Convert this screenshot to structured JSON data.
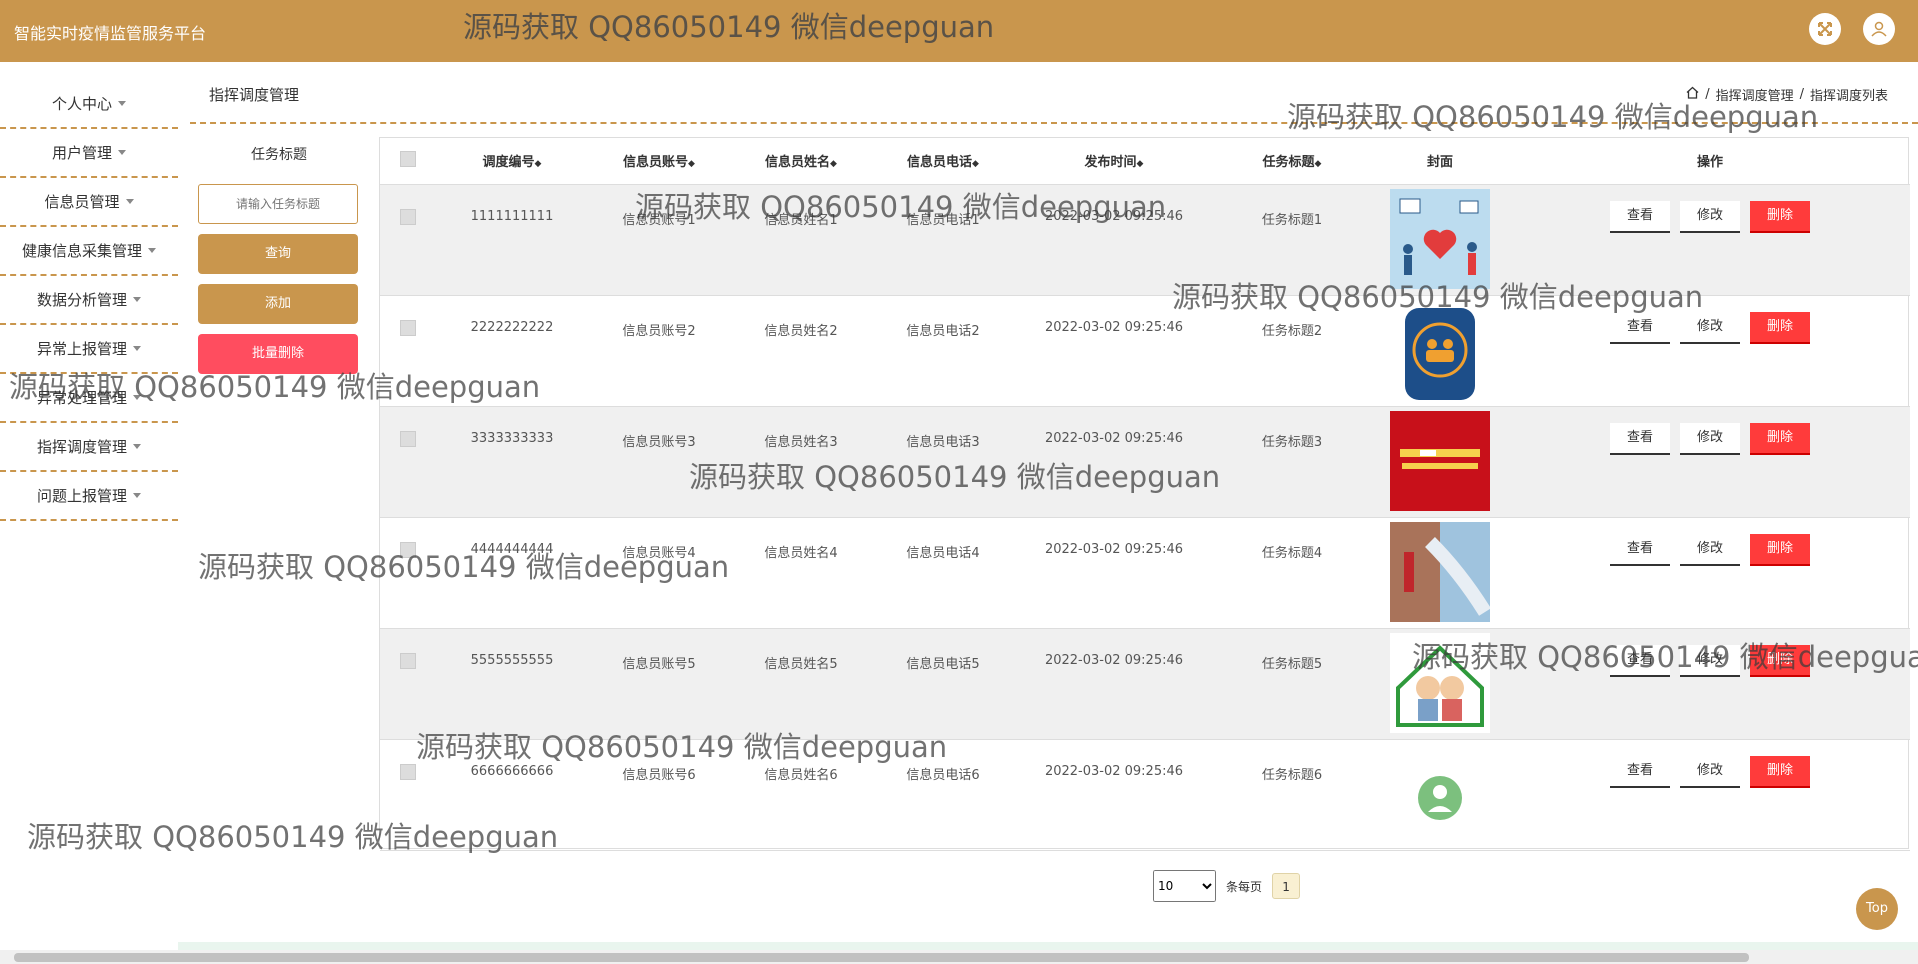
{
  "header": {
    "app_title": "智能实时疫情监管服务平台",
    "watermark": "源码获取 QQ86050149 微信deepguan",
    "fullscreen_icon": "fullscreen-icon",
    "user_icon": "user-icon"
  },
  "sidebar": {
    "items": [
      {
        "label": "个人中心"
      },
      {
        "label": "用户管理"
      },
      {
        "label": "信息员管理"
      },
      {
        "label": "健康信息采集管理"
      },
      {
        "label": "数据分析管理"
      },
      {
        "label": "异常上报管理"
      },
      {
        "label": "异常处理管理"
      },
      {
        "label": "指挥调度管理"
      },
      {
        "label": "问题上报管理"
      }
    ]
  },
  "page": {
    "title": "指挥调度管理",
    "breadcrumb": [
      "指挥调度管理",
      "指挥调度列表"
    ]
  },
  "filter": {
    "label": "任务标题",
    "placeholder": "请输入任务标题",
    "search_label": "查询",
    "add_label": "添加",
    "batch_delete_label": "批量删除"
  },
  "table": {
    "columns": [
      "调度编号",
      "信息员账号",
      "信息员姓名",
      "信息员电话",
      "发布时间",
      "任务标题",
      "封面",
      "操作"
    ],
    "rows": [
      {
        "id": "1111111111",
        "account": "信息员账号1",
        "name": "信息员姓名1",
        "phone": "信息员电话1",
        "time": "2022-03-02 09:25:46",
        "title": "任务标题1",
        "cover": "medical-heart-illustration"
      },
      {
        "id": "2222222222",
        "account": "信息员账号2",
        "name": "信息员姓名2",
        "phone": "信息员电话2",
        "time": "2022-03-02 09:25:46",
        "title": "任务标题2",
        "cover": "community-app-icon"
      },
      {
        "id": "3333333333",
        "account": "信息员账号3",
        "name": "信息员姓名3",
        "phone": "信息员电话3",
        "time": "2022-03-02 09:25:46",
        "title": "任务标题3",
        "cover": "red-banner-poster"
      },
      {
        "id": "4444444444",
        "account": "信息员账号4",
        "name": "信息员姓名4",
        "phone": "信息员电话4",
        "time": "2022-03-02 09:25:46",
        "title": "任务标题4",
        "cover": "face-mask-photo"
      },
      {
        "id": "5555555555",
        "account": "信息员账号5",
        "name": "信息员姓名5",
        "phone": "信息员电话5",
        "time": "2022-03-02 09:25:46",
        "title": "任务标题5",
        "cover": "elderly-couple-house"
      },
      {
        "id": "6666666666",
        "account": "信息员账号6",
        "name": "信息员姓名6",
        "phone": "信息员电话6",
        "time": "2022-03-02 09:25:46",
        "title": "任务标题6",
        "cover": "doctor-avatar-icon"
      }
    ],
    "actions": {
      "view": "查看",
      "edit": "修改",
      "delete": "删除"
    }
  },
  "pagination": {
    "page_size": "10",
    "per_page_label": "条每页",
    "current_page": "1"
  },
  "top_button": "Top",
  "colors": {
    "brand": "#c9964d",
    "danger": "#ff3b3b",
    "batch_delete": "#ff4d5f"
  }
}
